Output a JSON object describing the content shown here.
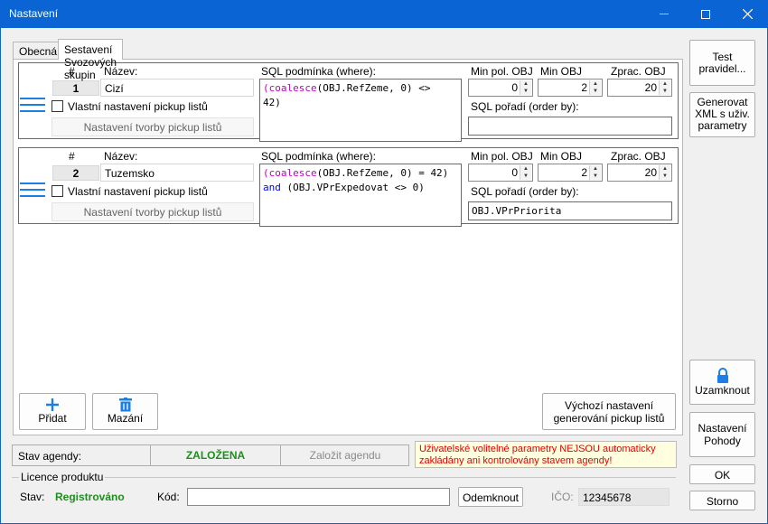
{
  "window": {
    "title": "Nastavení"
  },
  "tabs": [
    {
      "label": "Obecná"
    },
    {
      "label": "Sestavení Svozových skupin"
    }
  ],
  "headers": {
    "num": "#",
    "name": "Název:",
    "sql_where": "SQL podmínka (where):",
    "min_pol": "Min pol. OBJ",
    "min_obj": "Min OBJ",
    "zprac": "Zprac. OBJ",
    "sql_order": "SQL pořadí (order by):"
  },
  "groups": [
    {
      "num": "1",
      "name": "Cizí",
      "custom_pick_label": "Vlastní nastavení pickup listů",
      "pick_settings_label": "Nastavení tvorby pickup listů",
      "sql_line1_kw": "(coalesce",
      "sql_line1_rest": "(OBJ.RefZeme, 0) <>",
      "sql_line2_kw": "",
      "sql_line2_rest": "42)",
      "min_pol": "0",
      "min_obj": "2",
      "zprac": "20",
      "order_by": ""
    },
    {
      "num": "2",
      "name": "Tuzemsko",
      "custom_pick_label": "Vlastní nastavení pickup listů",
      "pick_settings_label": "Nastavení tvorby pickup listů",
      "sql_line1_kw": "(coalesce",
      "sql_line1_rest": "(OBJ.RefZeme, 0) = 42)",
      "sql_line2_kw": "and",
      "sql_line2_rest": " (OBJ.VPrExpedovat <> 0)",
      "min_pol": "0",
      "min_obj": "2",
      "zprac": "20",
      "order_by": "OBJ.VPrPriorita"
    }
  ],
  "buttons": {
    "add": "Přidat",
    "delete": "Mazání",
    "default_pick_line1": "Výchozí nastavení",
    "default_pick_line2": "generování pickup listů",
    "test_line1": "Test",
    "test_line2": "pravidel...",
    "gen_line1": "Generovat",
    "gen_line2": "XML s uživ.",
    "gen_line3": "parametry",
    "lock": "Uzamknout",
    "pohoda_line1": "Nastavení",
    "pohoda_line2": "Pohody",
    "ok": "OK",
    "cancel": "Storno"
  },
  "agenda": {
    "label": "Stav agendy:",
    "status": "ZALOŽENA",
    "create": "Založit agendu"
  },
  "warning": "Uživatelské volitelné parametry NEJSOU automaticky zakládány ani kontrolovány stavem agendy!",
  "licence": {
    "title": "Licence produktu",
    "state_label": "Stav:",
    "state_value": "Registrováno",
    "code_label": "Kód:",
    "code_value": "",
    "unlock": "Odemknout",
    "ico_label": "IČO:",
    "ico_value": "12345678"
  },
  "colors": {
    "titlebar": "#0a64d4",
    "accent": "#1a7fe6",
    "registered": "#1e8e1e",
    "warning": "#e00000"
  }
}
